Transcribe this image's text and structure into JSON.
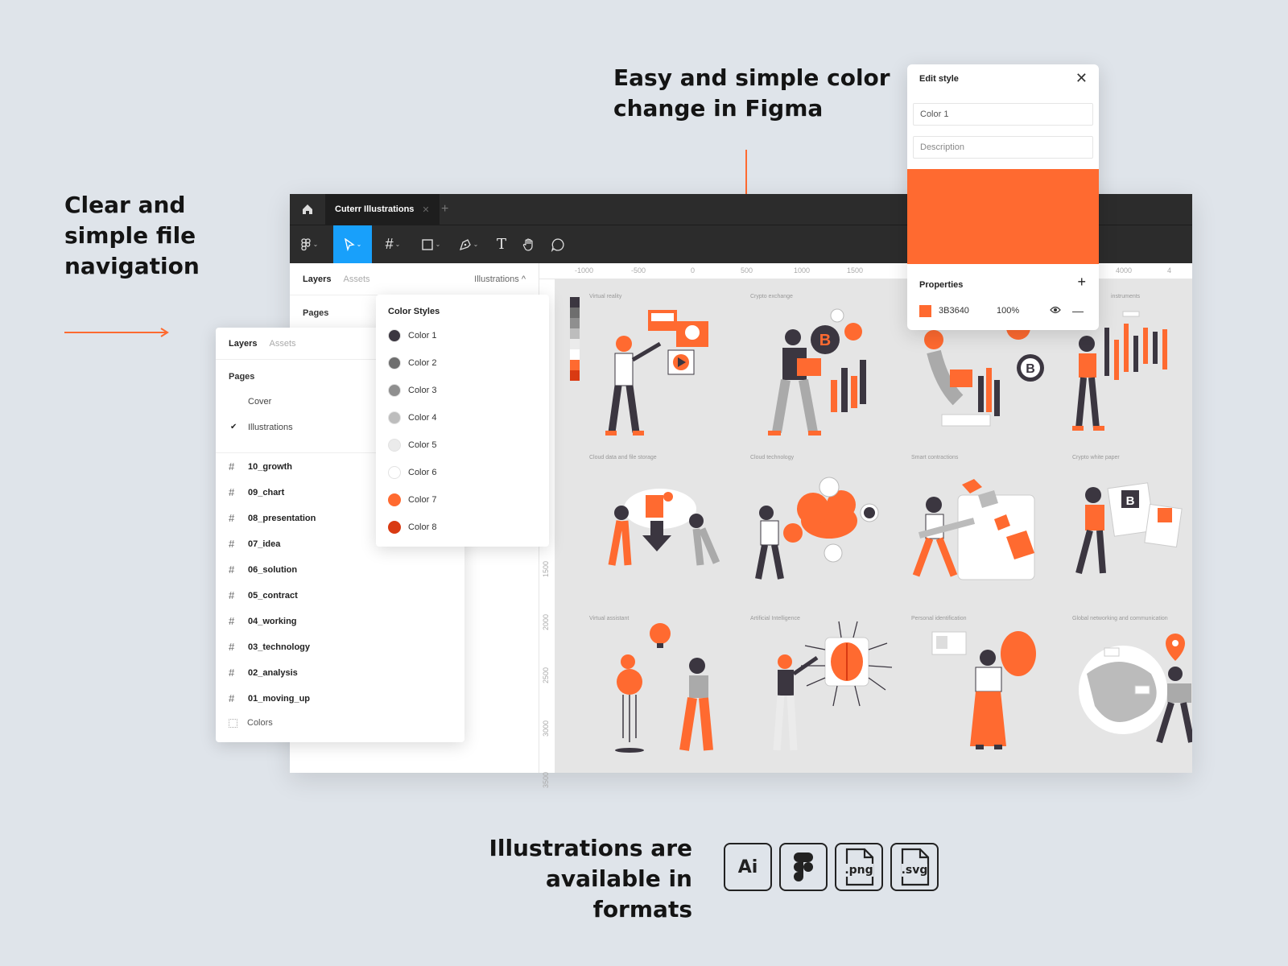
{
  "headings": {
    "left": "Clear and\nsimple file\nnavigation",
    "top": "Easy and simple color\nchange in Figma",
    "bottom": "Illustrations are\navailable in formats"
  },
  "colors": {
    "accent": "#ff6a30",
    "dark_bar": "#2c2c2c",
    "background": "#dfe4ea",
    "selection_blue": "#18a0fb"
  },
  "figma": {
    "tab_label": "Cuterr Illustrations",
    "layers_tab": "Layers",
    "assets_tab": "Assets",
    "current_page": "Illustrations ^",
    "pages_label": "Pages",
    "ruler_top": [
      "-1000",
      "-500",
      "0",
      "500",
      "1000",
      "1500",
      "4000",
      "4"
    ],
    "ruler_left": [
      "1500",
      "2000",
      "2500",
      "3000",
      "3500"
    ],
    "frame_labels": [
      "Virtual reality",
      "Crypto exchange",
      "",
      "instruments",
      "Cloud data and file storage",
      "Cloud technology",
      "Smart contractions",
      "Crypto white paper",
      "Virtual assistant",
      "Artificial Intelligence",
      "Personal identification",
      "Global networking and communication"
    ]
  },
  "layers_popup": {
    "layers_tab": "Layers",
    "assets_tab": "Assets",
    "pages_label": "Pages",
    "pages": [
      "Cover",
      "Illustrations"
    ],
    "frames": [
      "10_growth",
      "09_chart",
      "08_presentation",
      "07_idea",
      "06_solution",
      "05_contract",
      "04_working",
      "03_technology",
      "02_analysis",
      "01_moving_up"
    ],
    "colors_label": "Colors"
  },
  "color_styles": {
    "title": "Color Styles",
    "items": [
      {
        "label": "Color 1",
        "hex": "#3b3640"
      },
      {
        "label": "Color 2",
        "hex": "#6e6e6e"
      },
      {
        "label": "Color 3",
        "hex": "#8f8f8f"
      },
      {
        "label": "Color 4",
        "hex": "#bdbdbd"
      },
      {
        "label": "Color 5",
        "hex": "#ebebeb"
      },
      {
        "label": "Color 6",
        "hex": "#ffffff"
      },
      {
        "label": "Color 7",
        "hex": "#ff6a30"
      },
      {
        "label": "Color 8",
        "hex": "#d93a12"
      }
    ]
  },
  "edit_style": {
    "title": "Edit style",
    "name_value": "Color 1",
    "description_placeholder": "Description",
    "properties_label": "Properties",
    "fill_hex": "3B3640",
    "fill_opacity": "100%",
    "preview_color": "#ff6a30"
  },
  "formats": {
    "ai": "Ai",
    "png": ".png",
    "svg": ".svg"
  }
}
